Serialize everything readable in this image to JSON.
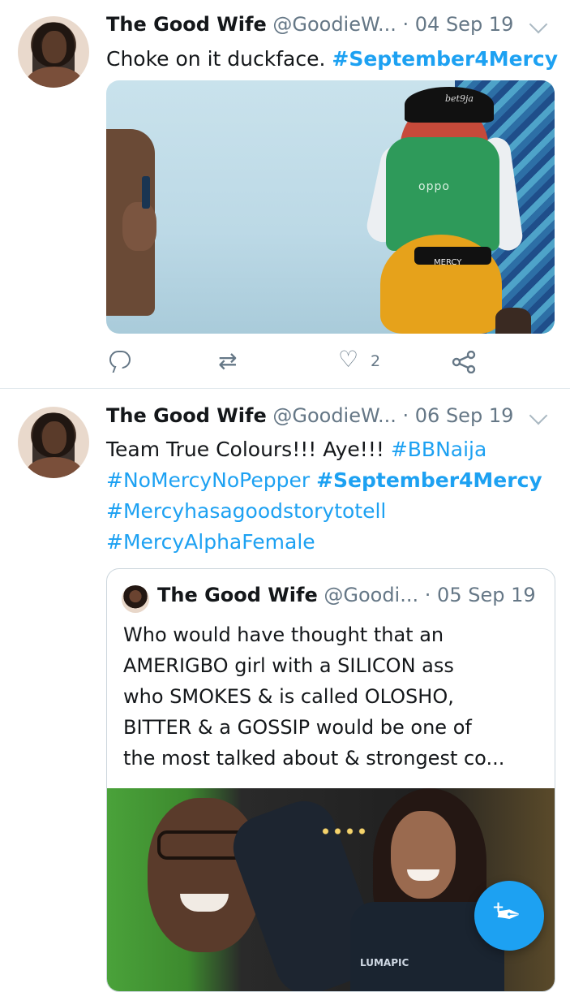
{
  "tweets": [
    {
      "author_name": "The Good Wife",
      "author_handle": "@GoodieW...",
      "separator": "·",
      "date": "04 Sep 19",
      "text_plain": "Choke on it duckface.",
      "hashtag_1": "#September4Mercy",
      "media_label_cap": "bet9ja",
      "media_label_jacket": "oppo",
      "media_label_belt": "MERCY",
      "like_count": "2"
    },
    {
      "author_name": "The Good Wife",
      "author_handle": "@GoodieW...",
      "separator": "·",
      "date": "06 Sep 19",
      "text_plain": "Team True Colours!!! Aye!!!",
      "hashtag_1": "#BBNaija",
      "hashtag_2": "#NoMercyNoPepper",
      "hashtag_3": "#September4Mercy",
      "hashtag_4": "#Mercyhasagoodstorytotell",
      "hashtag_5": "#MercyAlphaFemale",
      "quoted": {
        "author_name": "The Good Wife",
        "author_handle": "@Goodi...",
        "separator": "·",
        "date": "05 Sep 19",
        "text_line_1": "Who would have thought that an",
        "text_line_2": "AMERIGBO girl with a SILICON ass",
        "text_line_3": "who SMOKES & is called OLOSHO,",
        "text_line_4": "BITTER & a GOSSIP would be one of",
        "text_line_5": "the most talked about & strongest co...",
        "media_label_shirt": "LUMAPIC"
      }
    }
  ],
  "fab": {
    "plus": "+"
  },
  "colors": {
    "accent": "#1da1f2",
    "muted": "#657786",
    "text": "#14171a",
    "border": "#e1e8ed"
  }
}
